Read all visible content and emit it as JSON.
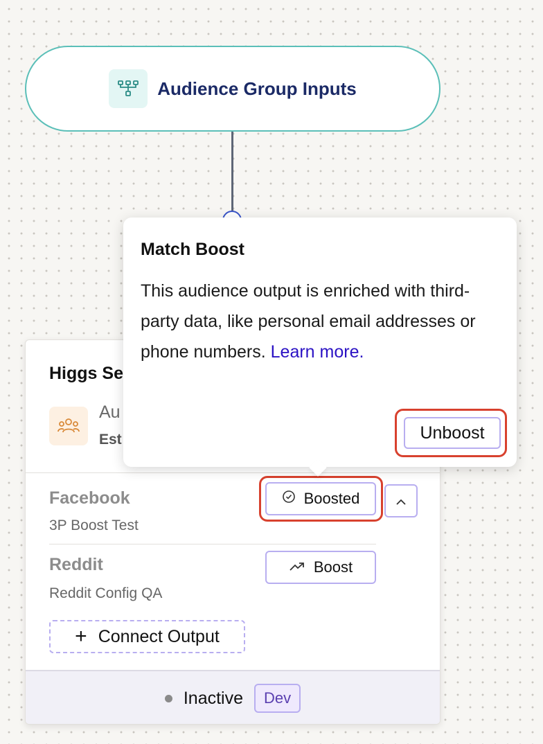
{
  "input_node": {
    "title": "Audience Group Inputs",
    "icon": "hierarchy-icon"
  },
  "destination_card": {
    "title": "Higgs Se",
    "audience": {
      "label": "Au",
      "estimate_label": "Est",
      "icon": "people-icon"
    },
    "outputs": [
      {
        "name": "Facebook",
        "config": "3P Boost Test",
        "action_label": "Boosted",
        "action_icon": "check-circle-icon",
        "toggle_icon": "chevron-up-icon"
      },
      {
        "name": "Reddit",
        "config": "Reddit Config QA",
        "action_label": "Boost",
        "action_icon": "trending-up-icon"
      }
    ],
    "connect_label": "Connect Output",
    "status": "Inactive",
    "environment": "Dev"
  },
  "popover": {
    "title": "Match Boost",
    "body": "This audience output is enriched with third-party data, like personal email addresses or phone numbers.",
    "link_label": "Learn more.",
    "action_label": "Unboost"
  },
  "colors": {
    "accent": "#b8aef0",
    "node_border": "#5bbfb8",
    "highlight": "#d8412e",
    "link": "#2b12c4",
    "title": "#1b2a66"
  }
}
